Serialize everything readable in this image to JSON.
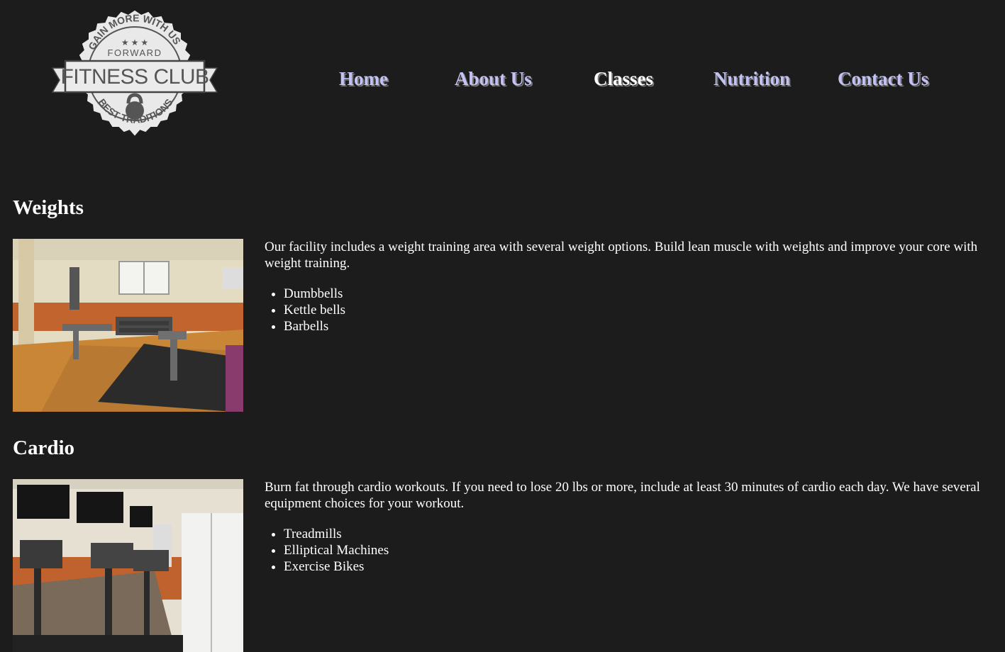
{
  "logo": {
    "top_arc": "GAIN MORE WITH US",
    "forward": "FORWARD",
    "name": "FITNESS CLUB",
    "bottom_arc": "BEST TRADITIONS"
  },
  "nav": {
    "items": [
      {
        "label": "Home",
        "active": false
      },
      {
        "label": "About Us",
        "active": false
      },
      {
        "label": "Classes",
        "active": true
      },
      {
        "label": "Nutrition",
        "active": false
      },
      {
        "label": "Contact Us",
        "active": false
      }
    ],
    "link_color": "#c4c2f5",
    "active_color": "#ffffff"
  },
  "sections": [
    {
      "title": "Weights",
      "description": "Our facility includes a weight training area with several weight options. Build lean muscle with weights and improve your core with weight training.",
      "items": [
        "Dumbbells",
        "Kettle bells",
        "Barbells"
      ]
    },
    {
      "title": "Cardio",
      "description": "Burn fat through cardio workouts. If you need to lose 20 lbs or more, include at least 30 minutes of cardio each day. We have several equipment choices for your workout.",
      "items": [
        "Treadmills",
        "Elliptical Machines",
        "Exercise Bikes"
      ]
    }
  ],
  "colors": {
    "background": "#1c1c1c",
    "text": "#ffffff"
  }
}
